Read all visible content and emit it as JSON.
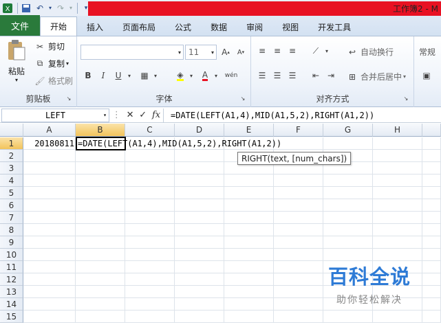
{
  "title_bar": {
    "title": "工作簿2 -  M"
  },
  "tabs": [
    {
      "label": "文件"
    },
    {
      "label": "开始"
    },
    {
      "label": "插入"
    },
    {
      "label": "页面布局"
    },
    {
      "label": "公式"
    },
    {
      "label": "数据"
    },
    {
      "label": "审阅"
    },
    {
      "label": "视图"
    },
    {
      "label": "开发工具"
    }
  ],
  "ribbon": {
    "clipboard": {
      "paste": "粘贴",
      "cut": "剪切",
      "copy": "复制",
      "format_painter": "格式刷",
      "label": "剪贴板"
    },
    "font": {
      "font_name": "",
      "font_size": "11",
      "label": "字体"
    },
    "alignment": {
      "wrap": "自动换行",
      "merge": "合并后居中",
      "label": "对齐方式"
    },
    "number": {
      "format": "常规"
    }
  },
  "formula_bar": {
    "name_box": "LEFT",
    "fx": "fx",
    "formula": "=DATE(LEFT(A1,4),MID(A1,5,2),RIGHT(A1,2))"
  },
  "columns": [
    "A",
    "B",
    "C",
    "D",
    "E",
    "F",
    "G",
    "H"
  ],
  "rows": [
    "1",
    "2",
    "3",
    "4",
    "5",
    "6",
    "7",
    "8",
    "9",
    "10",
    "11",
    "12",
    "13",
    "14",
    "15"
  ],
  "cells": {
    "A1": "20180811",
    "B1": "=DATE(LEFT(A1,4),MID(A1,5,2),RIGHT(A1,2))"
  },
  "tooltip": "RIGHT(text, [num_chars])",
  "watermark": {
    "title": "百科全说",
    "subtitle": "助你轻松解决"
  },
  "colors": {
    "file_tab": "#2a7a3b",
    "title_band": "#e81123",
    "selected_header": "#f2c45c"
  }
}
